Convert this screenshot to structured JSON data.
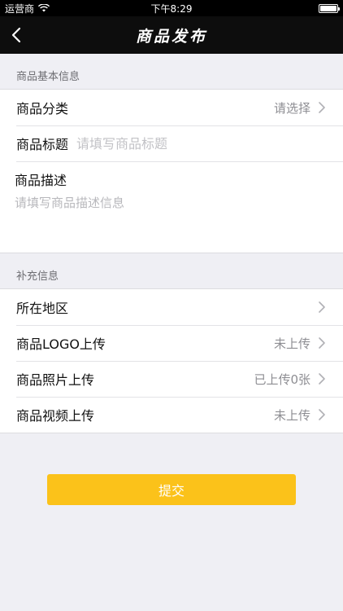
{
  "status_bar": {
    "carrier": "运营商",
    "time": "下午8:29",
    "battery_level": 1.0
  },
  "nav": {
    "title": "商品发布"
  },
  "basic_section": {
    "header": "商品基本信息",
    "category": {
      "label": "商品分类",
      "value": "请选择"
    },
    "title": {
      "label": "商品标题",
      "placeholder": "请填写商品标题"
    },
    "description": {
      "label": "商品描述",
      "placeholder": "请填写商品描述信息"
    }
  },
  "extra_section": {
    "header": "补充信息",
    "region": {
      "label": "所在地区"
    },
    "logo": {
      "label": "商品LOGO上传",
      "value": "未上传"
    },
    "photos": {
      "label": "商品照片上传",
      "value": "已上传0张"
    },
    "video": {
      "label": "商品视频上传",
      "value": "未上传"
    }
  },
  "submit": {
    "label": "提交"
  },
  "colors": {
    "accent": "#fbc21a",
    "nav_bg": "#0d0d0d",
    "page_bg": "#efeff4"
  }
}
